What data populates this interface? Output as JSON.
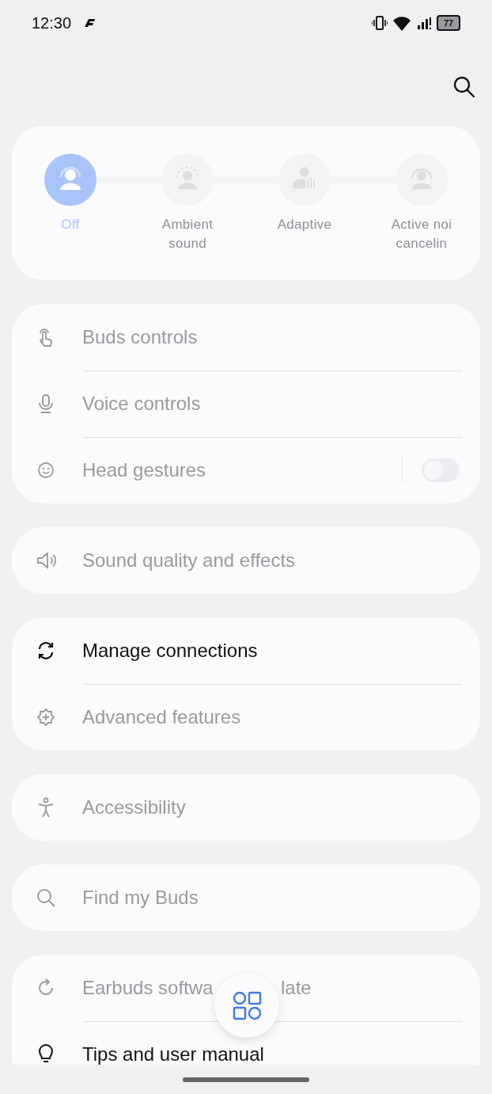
{
  "status_bar": {
    "time": "12:30",
    "battery": "77"
  },
  "modes": [
    {
      "label_lines": [
        "Off"
      ],
      "selected": true
    },
    {
      "label_lines": [
        "Ambient",
        "sound"
      ],
      "selected": false
    },
    {
      "label_lines": [
        "Adaptive"
      ],
      "selected": false
    },
    {
      "label_lines": [
        "Active noi",
        "cancelin"
      ],
      "selected": false
    }
  ],
  "groups": [
    {
      "items": [
        {
          "kind": "link",
          "label": "Buds controls",
          "disabled": true
        },
        {
          "kind": "link",
          "label": "Voice controls",
          "disabled": true
        },
        {
          "kind": "toggle",
          "label": "Head gestures",
          "disabled": true,
          "on": false
        }
      ]
    },
    {
      "items": [
        {
          "kind": "link",
          "label": "Sound quality and effects",
          "disabled": true
        }
      ]
    },
    {
      "items": [
        {
          "kind": "link",
          "label": "Manage connections",
          "disabled": false
        },
        {
          "kind": "link",
          "label": "Advanced features",
          "disabled": true
        }
      ]
    },
    {
      "items": [
        {
          "kind": "link",
          "label": "Accessibility",
          "disabled": true
        }
      ]
    },
    {
      "items": [
        {
          "kind": "link",
          "label": "Find my Buds",
          "disabled": true
        }
      ]
    },
    {
      "items": [
        {
          "kind": "link",
          "label": "Earbuds softwa",
          "label_tail": "late",
          "disabled": true
        },
        {
          "kind": "link",
          "label": "Tips and user manual",
          "disabled": false
        }
      ]
    }
  ]
}
